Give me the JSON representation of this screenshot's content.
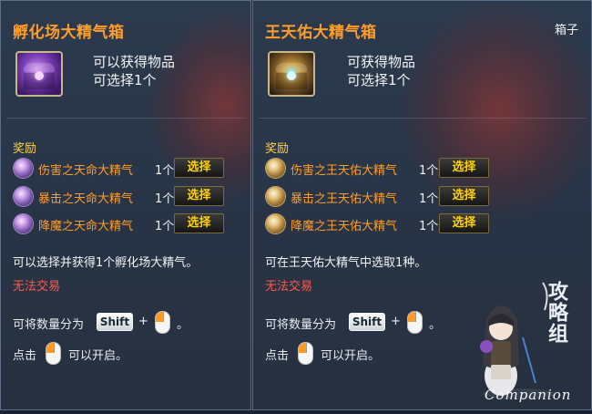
{
  "left_tooltip": {
    "title": "孵化场大精气箱",
    "obtain_line1": "可以获得物品",
    "obtain_line2": "可选择1个",
    "reward_header": "奖励",
    "rewards": [
      {
        "name": "伤害之天命大精气",
        "qty": "1个",
        "button": "选择"
      },
      {
        "name": "暴击之天命大精气",
        "qty": "1个",
        "button": "选择"
      },
      {
        "name": "降魔之天命大精气",
        "qty": "1个",
        "button": "选择"
      }
    ],
    "description": "可以选择并获得1个孵化场大精气。",
    "trade_status": "无法交易",
    "split_prefix": "可将数量分为",
    "shift_key": "Shift",
    "plus": "+",
    "period": "。",
    "open_prefix": "点击",
    "open_suffix": "可以开启。",
    "icon": "purple-treasure-chest-icon"
  },
  "right_tooltip": {
    "title": "王天佑大精气箱",
    "category": "箱子",
    "obtain_line1": "可获得物品",
    "obtain_line2": "可选择1个",
    "reward_header": "奖励",
    "rewards": [
      {
        "name": "伤害之王天佑大精气",
        "qty": "1个",
        "button": "选择"
      },
      {
        "name": "暴击之王天佑大精气",
        "qty": "1个",
        "button": "选择"
      },
      {
        "name": "降魔之王天佑大精气",
        "qty": "1个",
        "button": "选择"
      }
    ],
    "description": "可在王天佑大精气中选取1种。",
    "trade_status": "无法交易",
    "split_prefix": "可将数量分为",
    "shift_key": "Shift",
    "plus": "+",
    "period": "。",
    "open_prefix": "点击",
    "open_suffix": "可以开启。",
    "icon": "golden-treasure-chest-icon"
  },
  "watermark": {
    "calligraphy": "攻略组",
    "caption": "Companion"
  },
  "colors": {
    "title": "#ff9d2c",
    "reward_name": "#ff9d2c",
    "reward_header": "#ffd24a",
    "button_text": "#ffd200",
    "no_trade": "#ff5a4c",
    "panel_bg": "#2c3a4e"
  }
}
